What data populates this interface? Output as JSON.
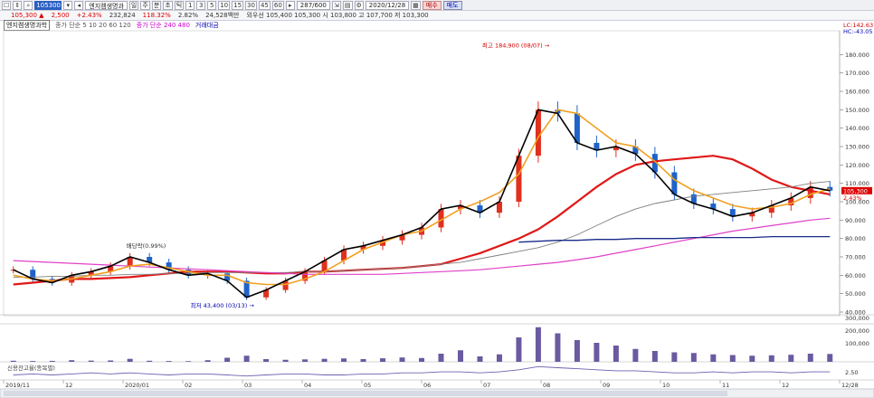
{
  "toolbar": {
    "code": "105300",
    "name": "엔지켐생명과",
    "buttons": [
      "주",
      "일",
      "분",
      "초",
      "틱",
      "1",
      "3",
      "5",
      "10",
      "15",
      "30",
      "45",
      "60"
    ],
    "count": "287/600",
    "date": "2020/12/28",
    "buy": "매수",
    "sell": "매도"
  },
  "quote": {
    "price": "105,300 ▲",
    "change": "2,500",
    "pct": "+2.43%",
    "volume": "232,824",
    "vol_pct": "118.32%",
    "turn": "2.82%",
    "amount": "24,528백만",
    "prices": "외우선 105,400 105,300 시 103,800 고 107,700 저 103,300"
  },
  "legend": {
    "title": "엔지켐생명과학",
    "ma_label": "종가 단순 5 10 20 60 120",
    "ma2_label": "종가 단순 240 480",
    "vol_label": "거래대금"
  },
  "right_labels": {
    "lc": "LC:142.63",
    "hc": "HC:-43.05",
    "price_tag": "105,300",
    "pct_tag": "2.43%"
  },
  "colors": {
    "up": "#e0301e",
    "down": "#1f63c9",
    "ma5": "#000000",
    "ma10": "#2a6fd6",
    "ma20": "#f0a020",
    "ma60": "#e01818",
    "ma120": "#808080",
    "ma240": "#e040c8",
    "trend": "#1a2a8a",
    "volume": "#6a5aa0",
    "credit": "#7060b0"
  },
  "chart_data": {
    "type": "line",
    "title": "",
    "ylabel": "",
    "ylim": [
      40000,
      190000
    ],
    "yticks": [
      40000,
      50000,
      60000,
      70000,
      80000,
      90000,
      100000,
      110000,
      120000,
      130000,
      140000,
      150000,
      160000,
      170000,
      180000
    ],
    "ytick_labels": [
      "40.000",
      "50.000",
      "60.000",
      "70.000",
      "80.000",
      "90.000",
      "100.000",
      "110.000",
      "120.000",
      "130.000",
      "140.000",
      "150.000",
      "160.000",
      "170.000",
      "180.000"
    ],
    "x_labels": [
      "2019/11",
      "12",
      "2020/01",
      "02",
      "03",
      "04",
      "05",
      "06",
      "07",
      "08",
      "09",
      "10",
      "11",
      "12",
      "12/28"
    ],
    "annotations": {
      "high": "최고 184,900 (08/07)",
      "low": "최저 43,400 (03/13)",
      "dividend": "배당락(0.99%)"
    },
    "series": [
      {
        "key": "ma60",
        "values": [
          55000,
          56000,
          57000,
          58000,
          58000,
          58500,
          59000,
          60000,
          61000,
          62000,
          62000,
          62000,
          61500,
          61000,
          61000,
          62000,
          62000,
          62500,
          63000,
          63500,
          64000,
          65000,
          66000,
          69000,
          72000,
          76000,
          80000,
          85000,
          92000,
          100000,
          108000,
          115000,
          120000,
          122000,
          123000,
          124000,
          125000,
          123000,
          118000,
          112000,
          108000,
          106000,
          104000
        ]
      },
      {
        "key": "ma120",
        "values": [
          59000,
          59000,
          59500,
          59500,
          60000,
          60000,
          60500,
          60500,
          61000,
          61000,
          61500,
          61500,
          61500,
          61500,
          61500,
          62000,
          62000,
          62500,
          63000,
          63500,
          64000,
          65000,
          66000,
          67000,
          69000,
          71000,
          73000,
          75000,
          78000,
          82000,
          87000,
          92000,
          96000,
          99000,
          101000,
          103000,
          104000,
          105000,
          106000,
          107000,
          108000,
          110000,
          111000
        ]
      },
      {
        "key": "ma240",
        "values": [
          68000,
          67500,
          67000,
          66500,
          66000,
          65500,
          65000,
          64500,
          64000,
          63500,
          63000,
          62500,
          62000,
          61500,
          61000,
          60500,
          60500,
          60500,
          60500,
          60500,
          61000,
          61500,
          62000,
          62500,
          63000,
          64000,
          65000,
          66000,
          67000,
          68500,
          70000,
          72000,
          74000,
          76000,
          78000,
          80000,
          82000,
          84000,
          85500,
          87000,
          88500,
          90000,
          91000
        ]
      },
      {
        "key": "ma20",
        "values": [
          60000,
          58000,
          57000,
          58000,
          60000,
          62000,
          65000,
          66000,
          64000,
          62000,
          60000,
          60000,
          56000,
          55000,
          55000,
          58000,
          62000,
          68000,
          74000,
          78000,
          82000,
          84000,
          90000,
          96000,
          100000,
          105000,
          115000,
          135000,
          150000,
          148000,
          140000,
          132000,
          130000,
          122000,
          112000,
          106000,
          102000,
          98000,
          96000,
          97000,
          99000,
          104000,
          107000
        ]
      },
      {
        "key": "ma5",
        "values": [
          63000,
          58000,
          56000,
          60000,
          62000,
          65000,
          70000,
          67000,
          63000,
          60000,
          61000,
          57000,
          48000,
          52000,
          57000,
          62000,
          68000,
          74000,
          76000,
          79000,
          82000,
          86000,
          96000,
          98000,
          94000,
          100000,
          125000,
          150000,
          148000,
          132000,
          128000,
          130000,
          126000,
          116000,
          104000,
          99000,
          96000,
          92000,
          94000,
          98000,
          102000,
          108000,
          106000
        ]
      },
      {
        "key": "trend",
        "values": [
          null,
          null,
          null,
          null,
          null,
          null,
          null,
          null,
          null,
          null,
          null,
          null,
          null,
          null,
          null,
          null,
          null,
          null,
          null,
          null,
          null,
          null,
          null,
          null,
          null,
          null,
          78000,
          78500,
          79000,
          79000,
          79500,
          79500,
          80000,
          80000,
          80000,
          80500,
          80500,
          80500,
          80500,
          81000,
          81000,
          81000,
          81000
        ]
      }
    ],
    "volume": [
      8,
      6,
      7,
      12,
      9,
      10,
      22,
      8,
      6,
      5,
      12,
      30,
      45,
      20,
      15,
      18,
      22,
      25,
      20,
      26,
      32,
      28,
      60,
      85,
      40,
      55,
      180,
      255,
      210,
      160,
      140,
      120,
      95,
      80,
      70,
      65,
      55,
      50,
      45,
      48,
      52,
      60,
      58
    ],
    "volume_ylim": [
      0,
      320
    ],
    "volume_ticks": [
      "300,000",
      "200,000",
      "100,000"
    ],
    "credit_label": "신용잔고율(종목별)",
    "credit_value": "2.50",
    "credit": [
      1.8,
      1.9,
      1.8,
      1.9,
      2.0,
      1.9,
      2.0,
      1.9,
      1.8,
      1.9,
      1.9,
      1.8,
      1.7,
      1.8,
      1.9,
      1.9,
      1.8,
      1.8,
      1.9,
      1.9,
      2.0,
      2.0,
      2.1,
      2.1,
      2.0,
      2.1,
      2.3,
      2.6,
      2.5,
      2.4,
      2.3,
      2.2,
      2.2,
      2.1,
      2.0,
      2.0,
      2.1,
      2.0,
      2.1,
      2.1,
      2.0,
      2.1,
      2.1
    ]
  }
}
